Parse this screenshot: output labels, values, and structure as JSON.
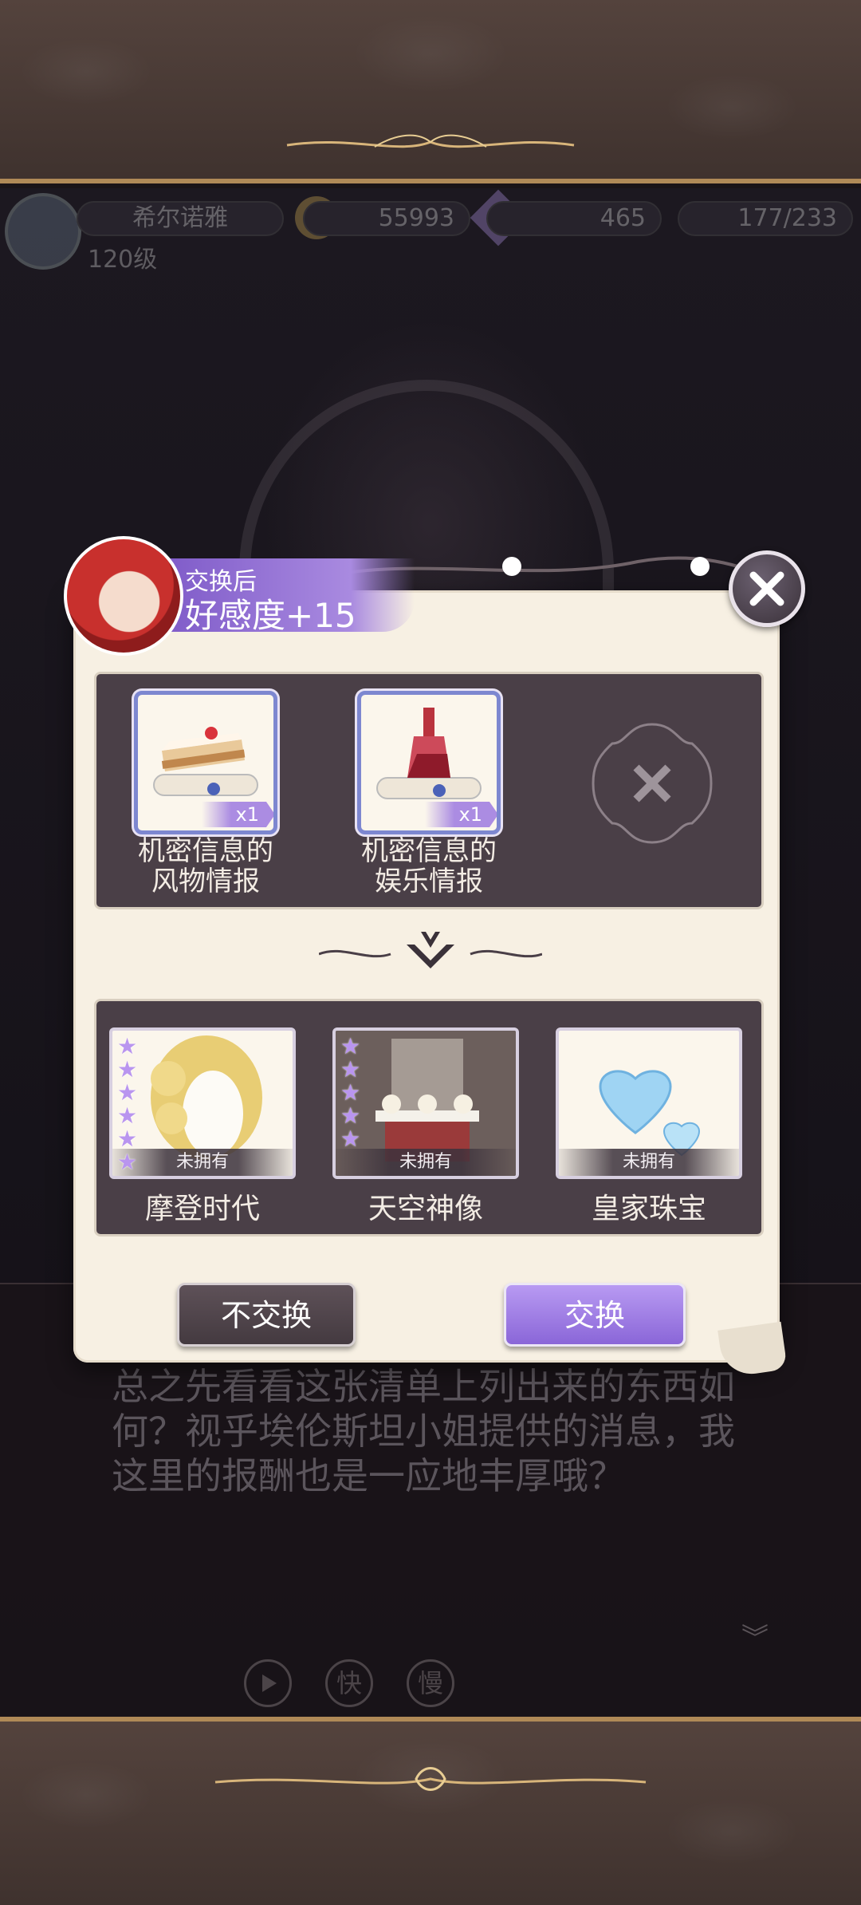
{
  "hud": {
    "player_name": "希尔诺雅",
    "level": "120级",
    "gold": "55993",
    "gems": "465",
    "energy": "177/233"
  },
  "dialogue": {
    "text": "总之先看看这张清单上列出来的东西如何？视乎埃伦斯坦小姐提供的消息，我这里的报酬也是一应地丰厚哦？"
  },
  "controls": {
    "auto_icon": "play-icon",
    "fast_label": "快",
    "slow_label": "慢"
  },
  "modal": {
    "banner_label": "交换后",
    "banner_value": "好感度+15",
    "close_icon": "close-icon",
    "give_items": [
      {
        "icon": "cake-scroll-icon",
        "qty": "x1",
        "label_line1": "机密信息的",
        "label_line2": "风物情报"
      },
      {
        "icon": "wine-scroll-icon",
        "qty": "x1",
        "label_line1": "机密信息的",
        "label_line2": "娱乐情报"
      }
    ],
    "empty_slot_icon": "empty-slot-icon",
    "rewards": [
      {
        "icon": "blonde-hair-icon",
        "status": "未拥有",
        "label": "摩登时代",
        "stars": 6
      },
      {
        "icon": "wedding-altar-icon",
        "status": "未拥有",
        "label": "天空神像",
        "stars": 5
      },
      {
        "icon": "heart-diamond-icon",
        "status": "未拥有",
        "label": "皇家珠宝",
        "stars": 0
      }
    ],
    "decline_label": "不交换",
    "accept_label": "交换"
  },
  "colors": {
    "accent_purple": "#9a78e0",
    "panel_dark": "#4a3f47",
    "paper": "#f7f0e3"
  }
}
